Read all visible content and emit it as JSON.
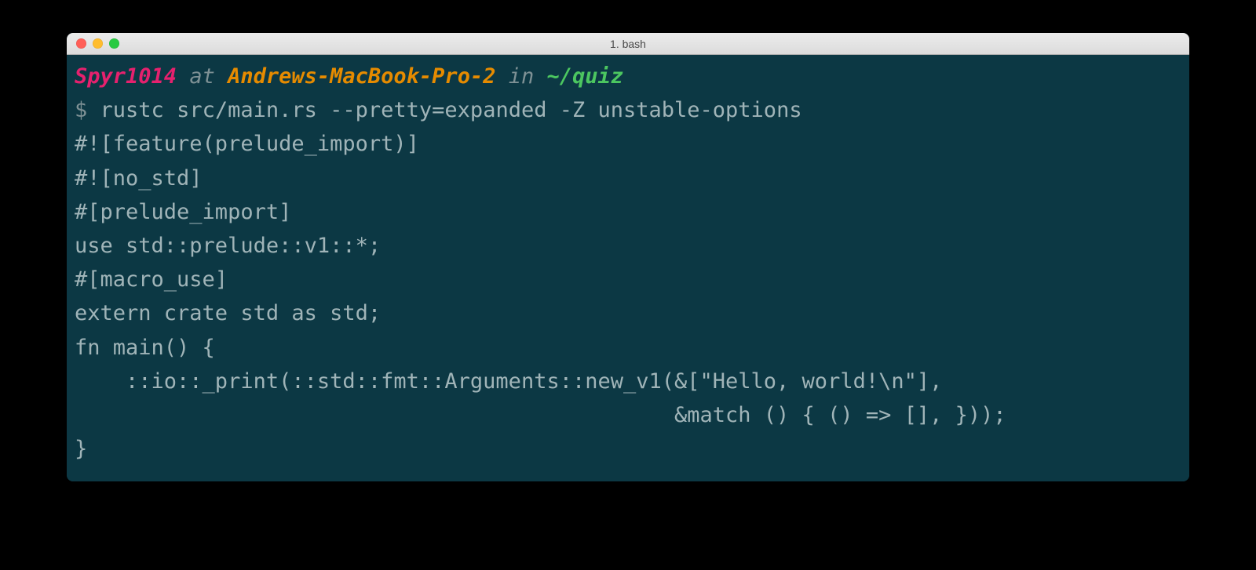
{
  "window": {
    "title": "1. bash"
  },
  "prompt": {
    "user": "Spyr1014",
    "at": "at",
    "host": "Andrews-MacBook-Pro-2",
    "in": "in",
    "path": "~/quiz",
    "symbol": "$"
  },
  "command": "rustc src/main.rs --pretty=expanded -Z unstable-options",
  "output": {
    "l1": "#![feature(prelude_import)]",
    "l2": "#![no_std]",
    "l3": "#[prelude_import]",
    "l4": "use std::prelude::v1::*;",
    "l5": "#[macro_use]",
    "l6": "extern crate std as std;",
    "l7": "fn main() {",
    "l8": "    ::io::_print(::std::fmt::Arguments::new_v1(&[\"Hello, world!\\n\"],",
    "l9": "                                               &match () { () => [], }));",
    "l10": "}"
  },
  "colors": {
    "background": "#0c3844",
    "text": "#a0b4b8",
    "user": "#e6216e",
    "host": "#e68b00",
    "path": "#4cc760",
    "dim": "#7e9195"
  }
}
